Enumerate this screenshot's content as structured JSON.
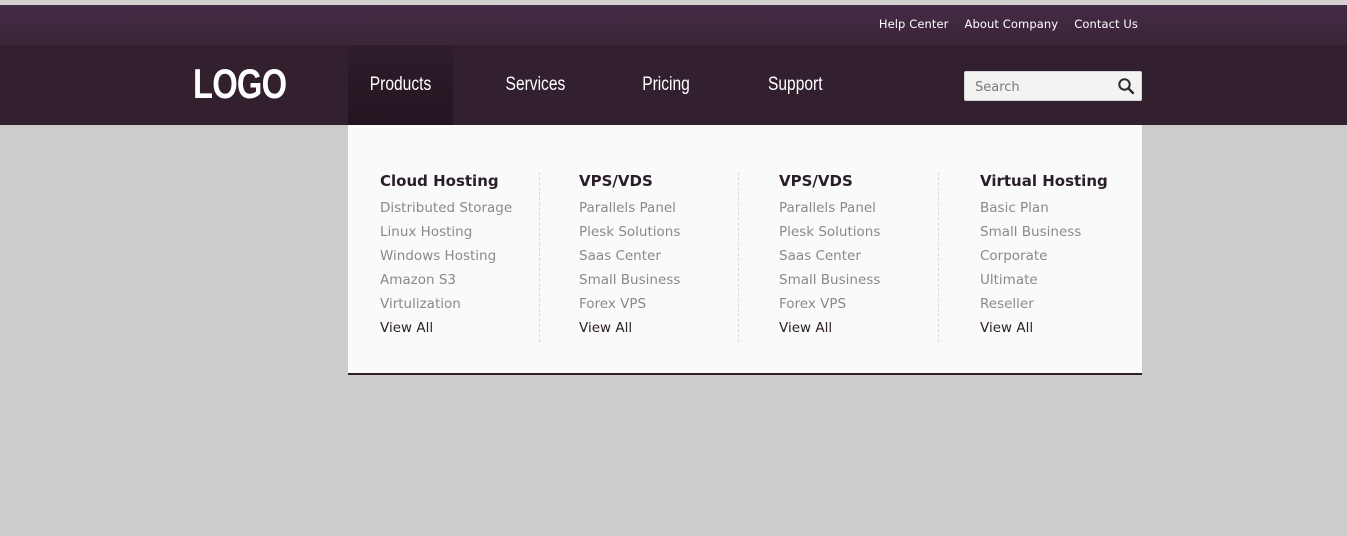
{
  "top_links": [
    "Help Center",
    "About Company",
    "Contact Us"
  ],
  "logo": "LOGO",
  "nav": [
    {
      "label": "Products",
      "active": true
    },
    {
      "label": "Services",
      "active": false
    },
    {
      "label": "Pricing",
      "active": false
    },
    {
      "label": "Support",
      "active": false
    }
  ],
  "search": {
    "placeholder": "Search",
    "icon": "magnifier-icon"
  },
  "mega_menu": [
    {
      "title": "Cloud Hosting",
      "items": [
        "Distributed Storage",
        "Linux Hosting",
        "Windows Hosting",
        "Amazon S3",
        "Virtulization"
      ],
      "view_all": "View All"
    },
    {
      "title": "VPS/VDS",
      "items": [
        "Parallels Panel",
        "Plesk Solutions",
        "Saas Center",
        "Small Business",
        "Forex VPS"
      ],
      "view_all": "View All"
    },
    {
      "title": "VPS/VDS",
      "items": [
        "Parallels Panel",
        "Plesk Solutions",
        "Saas Center",
        "Small Business",
        "Forex VPS"
      ],
      "view_all": "View All"
    },
    {
      "title": "Virtual Hosting",
      "items": [
        "Basic Plan",
        "Small Business",
        "Corporate",
        "Ultimate",
        "Reseller"
      ],
      "view_all": "View All"
    }
  ],
  "colors": {
    "header": "#33202f",
    "topbar": "#3f2740",
    "page_bg": "#cccccc",
    "menu_bg": "#fafafa"
  }
}
